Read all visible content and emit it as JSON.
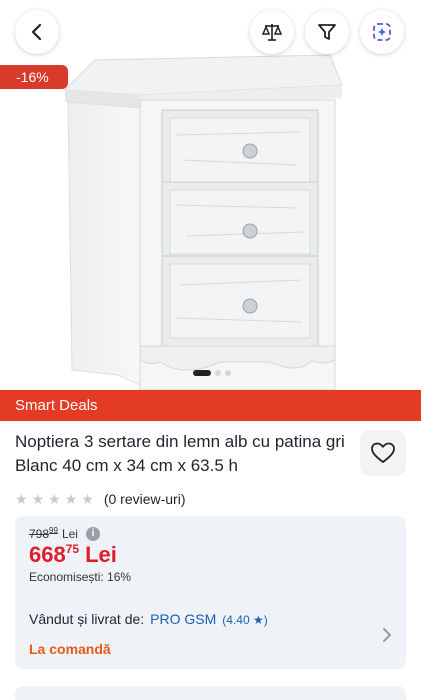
{
  "hero": {
    "discount_badge": "-16%",
    "gallery_index": 1,
    "gallery_count": 3
  },
  "top_bar": {
    "back_icon": "chevron-left-icon",
    "compare_icon": "compare-icon",
    "filter_icon": "filter-icon",
    "ai_icon": "ai-sparkle-icon"
  },
  "promo": {
    "label": "Smart Deals",
    "color": "#e33b24"
  },
  "product": {
    "title": "Noptiera 3 sertare din lemn alb cu patina gri Blanc 40 cm x 34 cm x 63.5 h",
    "rating_stars": 0,
    "reviews_label": "(0 review-uri)"
  },
  "pricing": {
    "old_price_int": "798",
    "old_price_dec": "99",
    "old_currency": "Lei",
    "new_price_int": "668",
    "new_price_dec": "75",
    "new_currency": "Lei",
    "savings": "Economisești: 16%",
    "price_color": "#e01e2b"
  },
  "seller": {
    "label": "Vândut și livrat de:",
    "name": "PRO GSM",
    "rating": "(4.40 ★)",
    "availability": "La comandă"
  }
}
